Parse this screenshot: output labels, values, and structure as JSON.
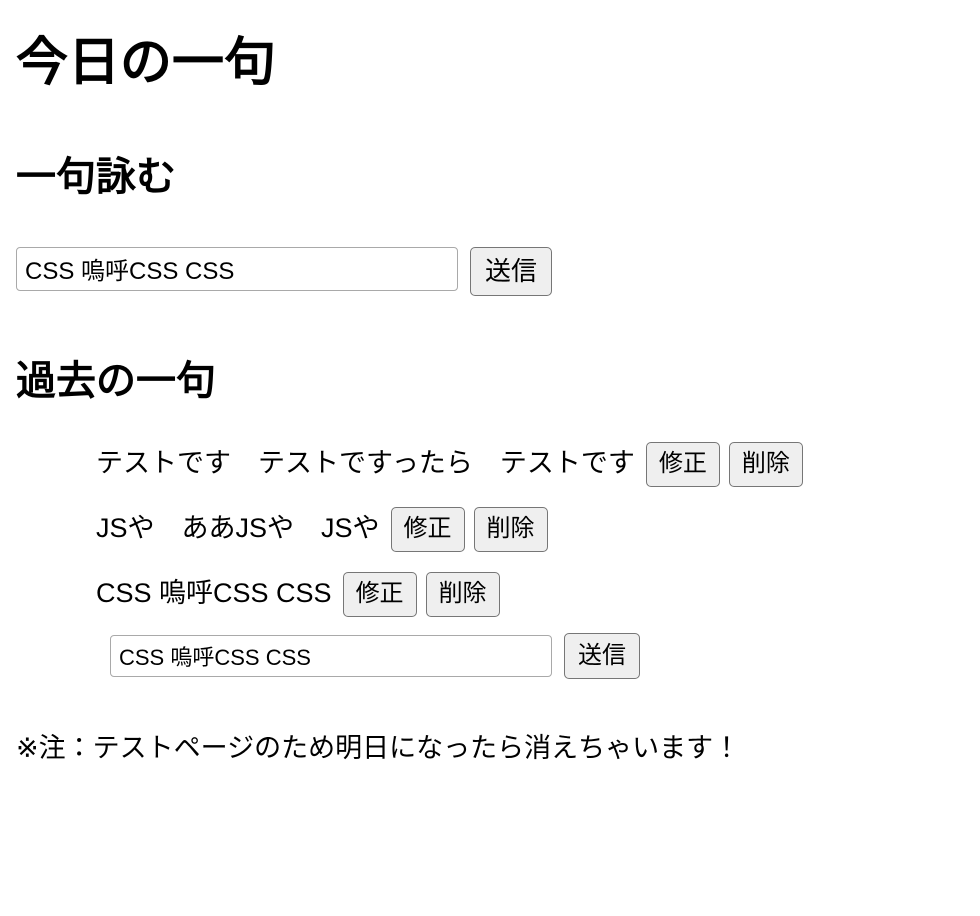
{
  "page": {
    "title": "今日の一句",
    "notice": "※注：テストページのため明日になったら消えちゃいます！"
  },
  "compose": {
    "heading": "一句詠む",
    "input_value": "CSS 嗚呼CSS CSS",
    "input_placeholder": "",
    "submit_label": "送信"
  },
  "past": {
    "heading": "過去の一句",
    "items": [
      {
        "text": "テストです　テストですったら　テストです",
        "edit_label": "修正",
        "delete_label": "削除"
      },
      {
        "text": "JSや　ああJSや　JSや",
        "edit_label": "修正",
        "delete_label": "削除"
      },
      {
        "text": "CSS 嗚呼CSS CSS",
        "edit_label": "修正",
        "delete_label": "削除"
      }
    ],
    "edit_form": {
      "input_value": "CSS 嗚呼CSS CSS",
      "input_placeholder": "",
      "submit_label": "送信"
    }
  },
  "colors": {
    "text": "#000000",
    "background": "#ffffff",
    "button_bg": "#efefef",
    "button_border": "#767676",
    "input_border": "#a9a9a9"
  }
}
